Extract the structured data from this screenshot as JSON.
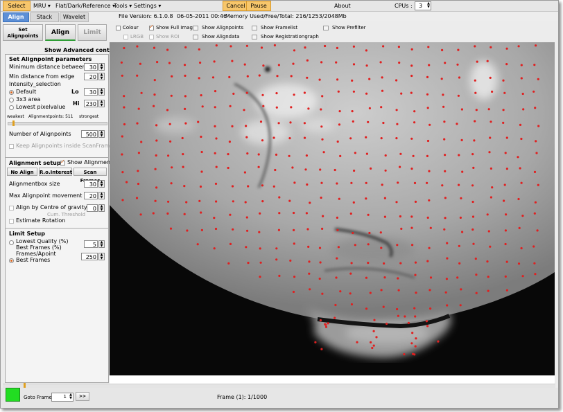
{
  "menubar": {
    "select": "Select",
    "mru": "MRU ▾",
    "flat": "Flat/Dark/Reference ▾",
    "tools": "Tools ▾",
    "settings": "Settings ▾",
    "cancel": "Cancel",
    "pause": "Pause",
    "about": "About",
    "cpus_label": "CPUs :",
    "cpus_value": "3"
  },
  "tabs": {
    "align": "Align",
    "stack": "Stack",
    "wavelet": "Wavelet"
  },
  "status": {
    "version": "File Version: 6.1.0.8",
    "date": "06-05-2011 00:46",
    "memory": "Memory Used/Free/Total: 216/1253/2048Mb"
  },
  "left": {
    "set_alignpoints": "Set\nAlignpoints",
    "align_btn": "Align",
    "limit_btn": "Limit",
    "show_advanced": "Show Advanced controls",
    "params_title": "Set Alignpoint parameters",
    "min_distance": "Minimum distance between",
    "min_distance_val": "30",
    "min_edge": "Min distance from edge",
    "min_edge_val": "20",
    "intensity_title": "Intensity_selection",
    "default": "Default",
    "area3": "3x3 area",
    "lowest": "Lowest pixelvalue",
    "lo": "Lo",
    "lo_val": "30",
    "hi": "Hi",
    "hi_val": "230",
    "weakest": "weakest",
    "alignpoints_count": "Alignmentpoints: 511",
    "strongest": "strongest",
    "number_label": "Number of Alignpoints",
    "number_val": "500",
    "keep_inside": "Keep Alignpoints inside ScanFrame",
    "alignment_setup": "Alignment setup",
    "show_alignment": "Show Alignment",
    "no_align": "No Align",
    "ro_interest": "R.o.Interest",
    "scan_frames": "Scan Frames",
    "box_size": "Alignmentbox size",
    "box_size_val": "30",
    "max_move": "Max Alignpoint movement",
    "max_move_val": "20",
    "centre_gravity": "Align by Centre of gravity",
    "cog_val": "0",
    "cum_threshold": "Cum. Threshold",
    "estimate_rotation": "Estimate Rotation",
    "limit_setup": "Limit Setup",
    "lowest_quality": "Lowest Quality (%)",
    "best_frames_pct": "Best Frames (%)",
    "quality_val": "5",
    "frames_apoint": "Frames/Apoint",
    "best_frames": "Best Frames",
    "best_val": "250"
  },
  "options": {
    "colour": "Colour",
    "show_full_image": "Show Full Image",
    "show_alignpoints": "Show Alignpoints",
    "show_framelist": "Show Framelist",
    "show_prefilter": "Show Prefilter",
    "lrgb": "LRGB",
    "show_roi": "Show ROI",
    "show_aligndata": "Show Aligndata",
    "show_registrationgraph": "Show Registrationgraph"
  },
  "bottom": {
    "goto_frame": "Goto Frame",
    "goto_val": "1",
    "goto_btn": ">>",
    "frame_status": "Frame (1): 1/1000"
  },
  "colors": {
    "accent_orange": "#f7c66b",
    "tab_blue": "#5c8fd6",
    "alignpoint_red": "#e02020",
    "status_green": "#22dd22"
  }
}
